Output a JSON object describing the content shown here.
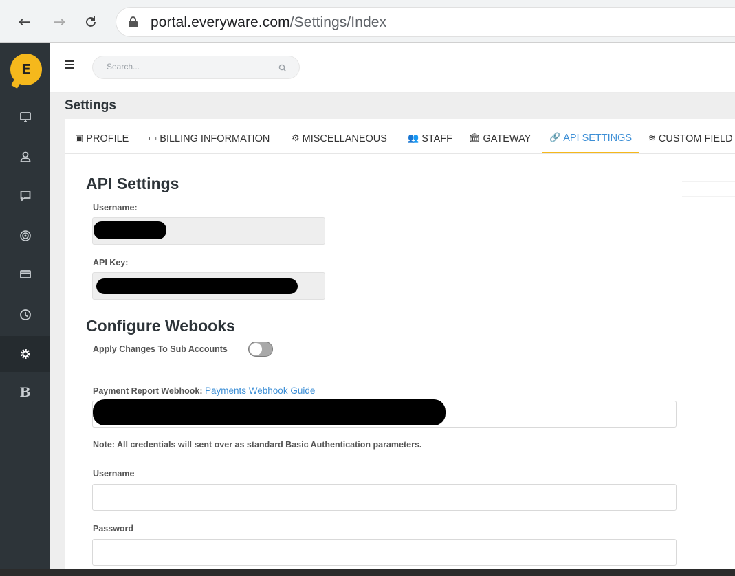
{
  "browser": {
    "url_host": "portal.everyware.com",
    "url_path": "/Settings/Index",
    "back_glyph": "←",
    "forward_glyph": "→",
    "reload_glyph": "C"
  },
  "sidebar": {
    "logo_letter": "E",
    "items": [
      {
        "name": "monitor-icon"
      },
      {
        "name": "user-icon"
      },
      {
        "name": "chat-icon"
      },
      {
        "name": "target-icon"
      },
      {
        "name": "card-icon"
      },
      {
        "name": "clock-icon"
      },
      {
        "name": "gear-icon",
        "active": true
      },
      {
        "name": "b-icon",
        "label": "B"
      }
    ]
  },
  "header": {
    "search_placeholder": "Search..."
  },
  "page": {
    "title": "Settings"
  },
  "tabs": [
    {
      "label": "PROFILE",
      "icon": "id-card-icon"
    },
    {
      "label": "BILLING INFORMATION",
      "icon": "billing-card-icon"
    },
    {
      "label": "MISCELLANEOUS",
      "icon": "cog-icon"
    },
    {
      "label": "STAFF",
      "icon": "people-icon"
    },
    {
      "label": "GATEWAY",
      "icon": "bank-icon"
    },
    {
      "label": "API SETTINGS",
      "icon": "link-icon",
      "active": true
    },
    {
      "label": "CUSTOM FIELD",
      "icon": "stack-icon"
    }
  ],
  "api_settings": {
    "heading": "API Settings",
    "username_label": "Username:",
    "api_key_label": "API Key:"
  },
  "webhooks": {
    "heading": "Configure Webooks",
    "apply_sub_accounts_label": "Apply Changes To Sub Accounts",
    "apply_sub_accounts_on": false,
    "payment_report_label": "Payment Report Webhook:",
    "payment_guide_link": "Payments Webhook Guide",
    "note": "Note: All credentials will sent over as standard Basic Authentication parameters.",
    "username_label": "Username",
    "username_value": "",
    "password_label": "Password",
    "password_value": ""
  },
  "colors": {
    "accent_yellow": "#f5b81c",
    "link_blue": "#3d8fd6",
    "sidebar_bg": "#2d3439"
  }
}
